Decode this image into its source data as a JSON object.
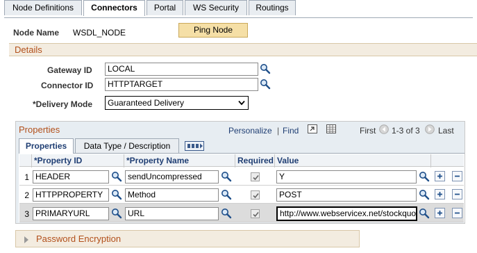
{
  "top_tabs": [
    {
      "label": "Node Definitions",
      "active": false
    },
    {
      "label": "Connectors",
      "active": true
    },
    {
      "label": "Portal",
      "active": false
    },
    {
      "label": "WS Security",
      "active": false
    },
    {
      "label": "Routings",
      "active": false
    }
  ],
  "node": {
    "label": "Node Name",
    "value": "WSDL_NODE",
    "ping_label": "Ping Node"
  },
  "details": {
    "title": "Details"
  },
  "form": {
    "gateway_label": "Gateway ID",
    "gateway_value": "LOCAL",
    "connector_label": "Connector ID",
    "connector_value": "HTTPTARGET",
    "delivery_label": "*Delivery Mode",
    "delivery_value": "Guaranteed Delivery"
  },
  "properties": {
    "title": "Properties",
    "personalize": "Personalize",
    "separator": "|",
    "find": "Find",
    "first": "First",
    "range": "1-3 of 3",
    "last": "Last",
    "tabs": [
      "Properties",
      "Data Type / Description"
    ],
    "columns": {
      "property_id": "*Property ID",
      "property_name": "*Property Name",
      "required": "Required",
      "value": "Value"
    },
    "rows": [
      {
        "num": "1",
        "property_id": "HEADER",
        "property_name": "sendUncompressed",
        "required": true,
        "value": "Y"
      },
      {
        "num": "2",
        "property_id": "HTTPPROPERTY",
        "property_name": "Method",
        "required": true,
        "value": "POST"
      },
      {
        "num": "3",
        "property_id": "PRIMARYURL",
        "property_name": "URL",
        "required": true,
        "value": "http://www.webservicex.net/stockquote.asmx"
      }
    ]
  },
  "password_section": {
    "title": "Password Encryption"
  },
  "colors": {
    "accent_orange": "#b2501b",
    "link_blue": "#1f3e73",
    "ping_button": "#f5dfa6"
  }
}
